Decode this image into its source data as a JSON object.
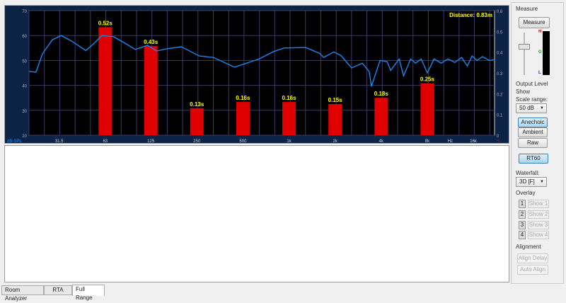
{
  "chart_data": {
    "type": "bar+line",
    "left_axis": {
      "label": "dB-SPL",
      "ylim": [
        20,
        70
      ],
      "ticks": [
        20,
        30,
        40,
        50,
        60,
        70
      ]
    },
    "right_axis": {
      "label": "s",
      "ylim": [
        0,
        0.6
      ],
      "ticks": [
        "0",
        "0.1",
        "0.2",
        "0.3",
        "0.4",
        "0.5",
        "0.6"
      ]
    },
    "x_axis": {
      "label": "Hz",
      "scale": "log",
      "xlim": [
        20,
        22000
      ],
      "ticks": [
        {
          "f": 31.5,
          "label": "31.5"
        },
        {
          "f": 63,
          "label": "63"
        },
        {
          "f": 125,
          "label": "125"
        },
        {
          "f": 250,
          "label": "250"
        },
        {
          "f": 500,
          "label": "500"
        },
        {
          "f": 1000,
          "label": "1k"
        },
        {
          "f": 2000,
          "label": "2k"
        },
        {
          "f": 4000,
          "label": "4k"
        },
        {
          "f": 8000,
          "label": "8k"
        },
        {
          "f": 16000,
          "label": "16k"
        }
      ],
      "hz_label_freq": 11300
    },
    "annotation": "Distance: 0.83m",
    "rt60_bars": [
      {
        "f": 63,
        "value": 0.52,
        "label": "0.52s"
      },
      {
        "f": 125,
        "value": 0.43,
        "label": "0.43s"
      },
      {
        "f": 250,
        "value": 0.13,
        "label": "0.13s"
      },
      {
        "f": 500,
        "value": 0.16,
        "label": "0.16s"
      },
      {
        "f": 1000,
        "value": 0.16,
        "label": "0.16s"
      },
      {
        "f": 2000,
        "value": 0.15,
        "label": "0.15s"
      },
      {
        "f": 4000,
        "value": 0.18,
        "label": "0.18s"
      },
      {
        "f": 8000,
        "value": 0.25,
        "label": "0.25s"
      }
    ],
    "response_curve": [
      [
        20,
        45.6
      ],
      [
        22.2,
        45.3
      ],
      [
        24.5,
        52.7
      ],
      [
        28.4,
        58.3
      ],
      [
        32.4,
        60
      ],
      [
        37.9,
        57.8
      ],
      [
        47,
        54
      ],
      [
        52.2,
        56.4
      ],
      [
        59.9,
        60
      ],
      [
        71.5,
        59.5
      ],
      [
        84.2,
        57
      ],
      [
        99,
        54.4
      ],
      [
        118.8,
        56.1
      ],
      [
        136.4,
        53.8
      ],
      [
        159.6,
        54.7
      ],
      [
        198,
        55.5
      ],
      [
        259,
        51.8
      ],
      [
        320,
        51.2
      ],
      [
        440,
        47.3
      ],
      [
        516,
        48.7
      ],
      [
        637,
        50.6
      ],
      [
        788,
        53.5
      ],
      [
        928,
        55
      ],
      [
        1283,
        55.2
      ],
      [
        1590,
        52.8
      ],
      [
        1680,
        51.2
      ],
      [
        1960,
        53.4
      ],
      [
        2180,
        52
      ],
      [
        2560,
        47
      ],
      [
        3010,
        48.9
      ],
      [
        3340,
        45.5
      ],
      [
        3450,
        39.6
      ],
      [
        3930,
        50
      ],
      [
        4370,
        49.5
      ],
      [
        4610,
        46
      ],
      [
        5240,
        50.6
      ],
      [
        5600,
        43.8
      ],
      [
        6230,
        50.6
      ],
      [
        6700,
        48.9
      ],
      [
        7300,
        50.6
      ],
      [
        8000,
        45
      ],
      [
        8860,
        50.6
      ],
      [
        9850,
        48.9
      ],
      [
        10900,
        50.6
      ],
      [
        12100,
        49.2
      ],
      [
        13400,
        51.2
      ],
      [
        14600,
        47.8
      ],
      [
        15700,
        51.8
      ],
      [
        16900,
        50
      ],
      [
        18300,
        51.5
      ],
      [
        20400,
        50
      ],
      [
        22000,
        50.3
      ]
    ],
    "colors": {
      "bar": "#e00000",
      "curve": "#1a86f0",
      "label": "#ffff00",
      "grid": "#3a3a6a",
      "bg": "#000000"
    }
  },
  "side": {
    "measure_header": "Measure",
    "measure_button": "Measure",
    "output_level": "Output Level",
    "meter_marks": [
      "H",
      "G",
      "L"
    ],
    "show": "Show",
    "scale_range": "Scale range:",
    "scale_value": "50 dB",
    "anechoic": "Anechoic",
    "ambient": "Ambient",
    "raw": "Raw",
    "rt60": "RT60",
    "waterfall": "Waterfall:",
    "waterfall_value": "3D [F]",
    "overlay": "Overlay",
    "overlay_items": [
      {
        "num": "1",
        "show": "Show 1"
      },
      {
        "num": "2",
        "show": "Show 2"
      },
      {
        "num": "3",
        "show": "Show 3"
      },
      {
        "num": "4",
        "show": "Show 4"
      }
    ],
    "alignment": "Alignment",
    "align_delay": "Align Delay",
    "auto_align": "Auto Align"
  },
  "tabs": [
    "Room Analyzer",
    "RTA",
    "Full Range"
  ]
}
